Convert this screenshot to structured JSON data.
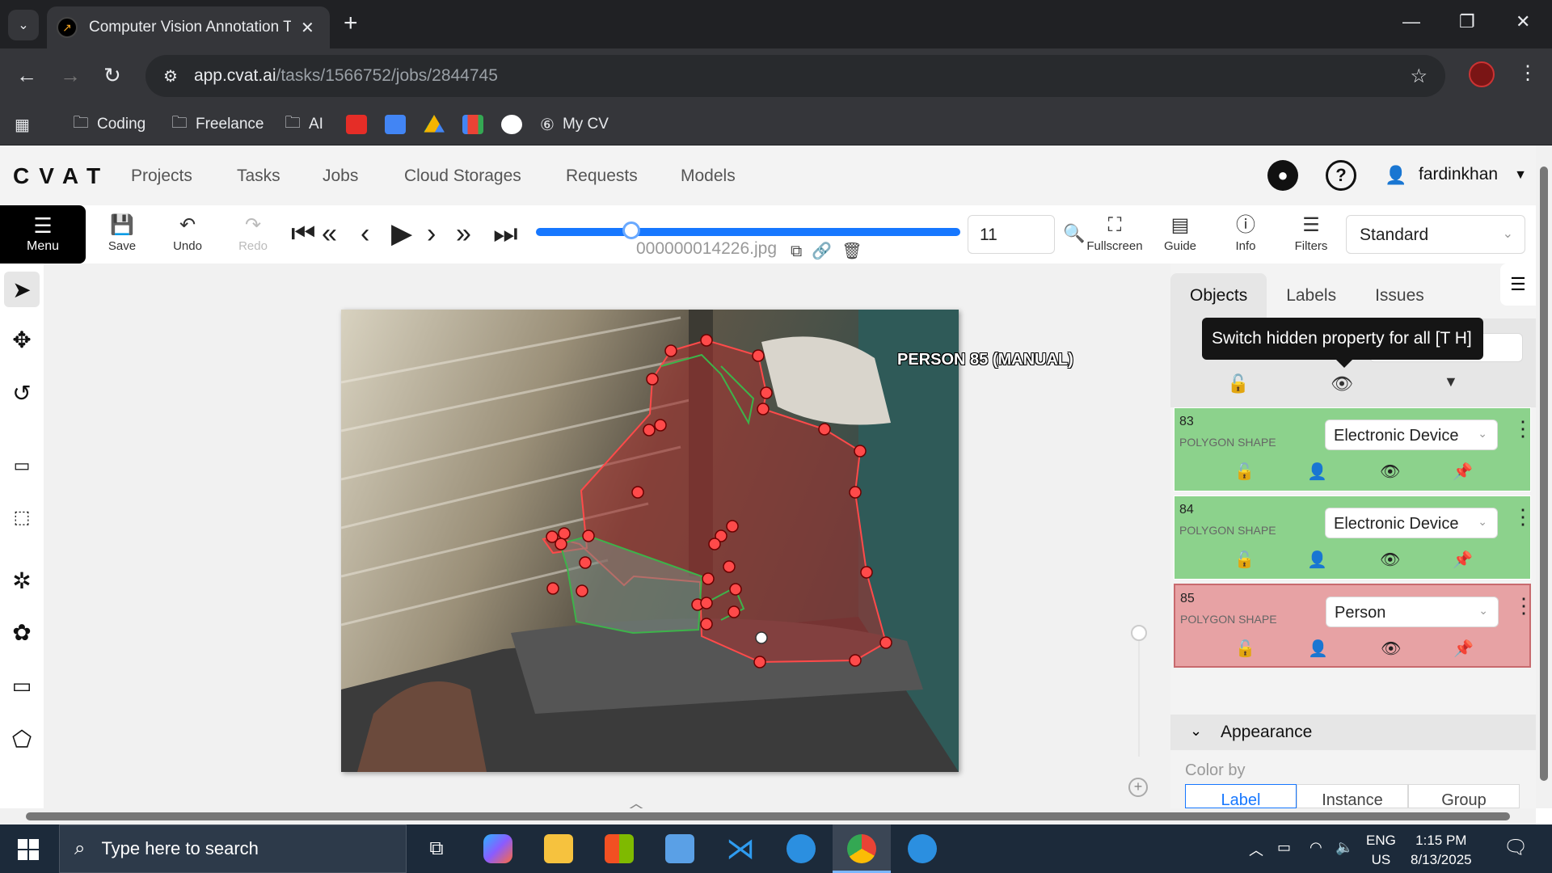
{
  "browser": {
    "tab_title": "Computer Vision Annotation To",
    "url_host": "app.cvat.ai",
    "url_path": "/tasks/1566752/jobs/2844745",
    "bookmarks": [
      "Coding",
      "Freelance",
      "AI",
      "My CV"
    ]
  },
  "header": {
    "logo": "CVAT",
    "nav": [
      "Projects",
      "Tasks",
      "Jobs",
      "Cloud Storages",
      "Requests",
      "Models"
    ],
    "username": "fardinkhan"
  },
  "toolbar": {
    "menu_label": "Menu",
    "save_label": "Save",
    "undo_label": "Undo",
    "redo_label": "Redo",
    "filename": "000000014226.jpg",
    "frame_number": "11",
    "fullscreen_label": "Fullscreen",
    "guide_label": "Guide",
    "info_label": "Info",
    "filters_label": "Filters",
    "workspace": "Standard",
    "frame_progress": 0.2
  },
  "canvas": {
    "object_label": "PERSON 85 (MANUAL)"
  },
  "sidebar": {
    "tabs": [
      "Objects",
      "Labels",
      "Issues"
    ],
    "tooltip": "Switch hidden property for all [T H]",
    "objects": [
      {
        "id": "83",
        "type": "POLYGON SHAPE",
        "label": "Electronic Device",
        "color": "#8cd28c"
      },
      {
        "id": "84",
        "type": "POLYGON SHAPE",
        "label": "Electronic Device",
        "color": "#8cd28c"
      },
      {
        "id": "85",
        "type": "POLYGON SHAPE",
        "label": "Person",
        "color": "#e7a2a4"
      }
    ],
    "appearance_title": "Appearance",
    "color_by_label": "Color by",
    "color_by_options": [
      "Label",
      "Instance",
      "Group"
    ]
  },
  "taskbar": {
    "search_placeholder": "Type here to search",
    "lang_top": "ENG",
    "lang_bottom": "US",
    "time": "1:15 PM",
    "date": "8/13/2025"
  }
}
